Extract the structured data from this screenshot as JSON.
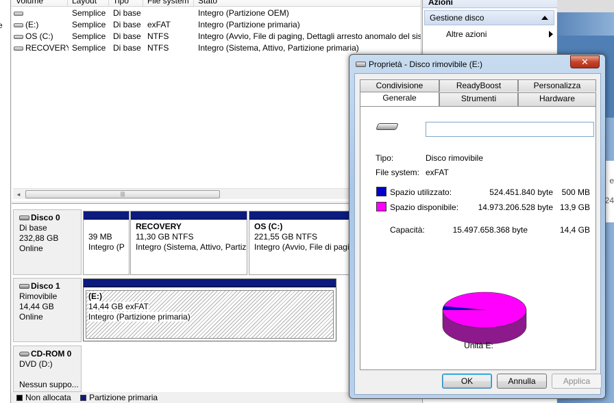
{
  "left_edge": {
    "text": "e"
  },
  "volume_list": {
    "columns": [
      "Volume",
      "Layout",
      "Tipo",
      "File system",
      "Stato"
    ],
    "rows": [
      {
        "volume": "",
        "layout": "Semplice",
        "tipo": "Di base",
        "fs": "",
        "stato": "Integro (Partizione OEM)"
      },
      {
        "volume": "(E:)",
        "layout": "Semplice",
        "tipo": "Di base",
        "fs": "exFAT",
        "stato": "Integro (Partizione primaria)"
      },
      {
        "volume": "OS (C:)",
        "layout": "Semplice",
        "tipo": "Di base",
        "fs": "NTFS",
        "stato": "Integro (Avvio, File di paging, Dettagli arresto anomalo del sis"
      },
      {
        "volume": "RECOVERY",
        "layout": "Semplice",
        "tipo": "Di base",
        "fs": "NTFS",
        "stato": "Integro (Sistema, Attivo, Partizione primaria)"
      }
    ],
    "scroll_left_icon": "◂",
    "scroll_grip": "|||"
  },
  "disks": [
    {
      "name": "Disco 0",
      "type": "Di base",
      "size": "232,88 GB",
      "status": "Online",
      "partitions": [
        {
          "title": "",
          "size": "39 MB",
          "status": "Integro (P"
        },
        {
          "title": "RECOVERY",
          "size": "11,30 GB NTFS",
          "status": "Integro (Sistema, Attivo, Partiz"
        },
        {
          "title": "OS  (C:)",
          "size": "221,55 GB NTFS",
          "status": "Integro (Avvio, File di pagi"
        }
      ]
    },
    {
      "name": "Disco 1",
      "type": "Rimovibile",
      "size": "14,44 GB",
      "status": "Online",
      "partitions": [
        {
          "title": "(E:)",
          "size": "14,44 GB exFAT",
          "status": "Integro (Partizione primaria)"
        }
      ]
    },
    {
      "name": "CD-ROM 0",
      "type": "DVD (D:)",
      "size": "",
      "status": "Nessun suppo..."
    }
  ],
  "legend": {
    "unallocated": "Non allocata",
    "primary": "Partizione primaria",
    "unallocated_color": "#000000",
    "primary_color": "#0b1b80"
  },
  "actions": {
    "title": "Azioni",
    "group": "Gestione disco",
    "more": "Altre azioni"
  },
  "bg_window": {
    "t1": "e",
    "t2": "24"
  },
  "dialog": {
    "title": "Proprietà - Disco rimovibile (E:)",
    "close_glyph": "✕",
    "tabs_row1": [
      "Condivisione",
      "ReadyBoost",
      "Personalizza"
    ],
    "tabs_row2": [
      "Generale",
      "Strumenti",
      "Hardware"
    ],
    "active_tab": "Generale",
    "label_value": "",
    "type_label": "Tipo:",
    "type_value": "Disco rimovibile",
    "fs_label": "File system:",
    "fs_value": "exFAT",
    "used": {
      "label": "Spazio utilizzato:",
      "bytes": "524.451.840 byte",
      "short": "500 MB",
      "color": "#0000cc",
      "value_bytes": 524451840
    },
    "free": {
      "label": "Spazio disponibile:",
      "bytes": "14.973.206.528 byte",
      "short": "13,9 GB",
      "color": "#ff00ff",
      "value_bytes": 14973206528
    },
    "capacity": {
      "label": "Capacità:",
      "bytes": "15.497.658.368 byte",
      "short": "14,4 GB"
    },
    "drive_label": "Unità E:",
    "buttons": {
      "ok": "OK",
      "cancel": "Annulla",
      "apply": "Applica"
    }
  }
}
